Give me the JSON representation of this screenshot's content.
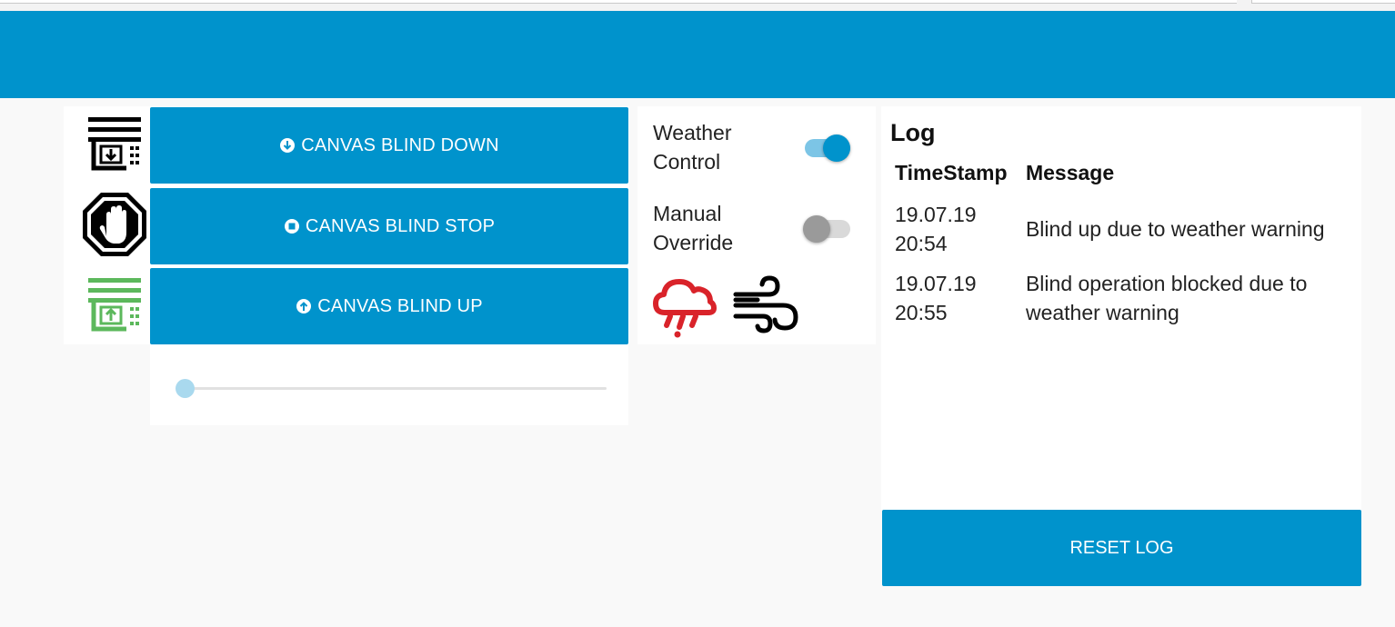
{
  "blind": {
    "buttons": [
      {
        "label": "CANVAS BLIND DOWN",
        "glyph": "arrow-down-circle-icon"
      },
      {
        "label": "CANVAS BLIND STOP",
        "glyph": "stop-circle-icon"
      },
      {
        "label": "CANVAS BLIND UP",
        "glyph": "arrow-up-circle-icon"
      }
    ],
    "icons": [
      "blind-down-icon",
      "stop-hand-icon",
      "blind-up-icon"
    ],
    "slider_value_fraction": 0.0
  },
  "weather": {
    "weather_control_label": "Weather Control",
    "weather_control_on": true,
    "manual_override_label": "Manual Override",
    "manual_override_on": false,
    "icons": [
      "rain-cloud-icon",
      "wind-icon"
    ]
  },
  "log": {
    "title": "Log",
    "columns": [
      "TimeStamp",
      "Message"
    ],
    "rows": [
      {
        "timestamp": "19.07.19 20:54",
        "message": "Blind up due to weather warning"
      },
      {
        "timestamp": "19.07.19 20:55",
        "message": "Blind operation blocked due to weather warning"
      }
    ],
    "reset_label": "RESET LOG"
  },
  "colors": {
    "primary": "#0093cc",
    "toggle_track_on": "#7cc5e6",
    "blind_up_icon": "#5cb85c",
    "rain_icon": "#d9232a"
  }
}
